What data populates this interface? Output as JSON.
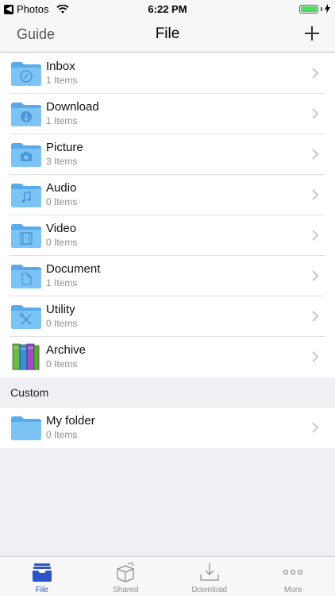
{
  "status_bar": {
    "back_app": "Photos",
    "time": "6:22 PM"
  },
  "navbar": {
    "left": "Guide",
    "title": "File",
    "add_icon": "plus-icon"
  },
  "folders": [
    {
      "name": "Inbox",
      "count": "1 Items",
      "icon": "inbox-folder-icon"
    },
    {
      "name": "Download",
      "count": "1 Items",
      "icon": "download-folder-icon"
    },
    {
      "name": "Picture",
      "count": "3 Items",
      "icon": "picture-folder-icon"
    },
    {
      "name": "Audio",
      "count": "0 Items",
      "icon": "audio-folder-icon"
    },
    {
      "name": "Video",
      "count": "0 Items",
      "icon": "video-folder-icon"
    },
    {
      "name": "Document",
      "count": "1 Items",
      "icon": "document-folder-icon"
    },
    {
      "name": "Utility",
      "count": "0 Items",
      "icon": "utility-folder-icon"
    },
    {
      "name": "Archive",
      "count": "0 Items",
      "icon": "archive-books-icon"
    }
  ],
  "custom_section": {
    "header": "Custom",
    "folders": [
      {
        "name": "My folder",
        "count": "0 Items",
        "icon": "folder-icon"
      }
    ]
  },
  "tabbar": {
    "tabs": [
      {
        "label": "File",
        "icon": "file-tray-icon",
        "active": true
      },
      {
        "label": "Shared",
        "icon": "shared-box-icon",
        "active": false
      },
      {
        "label": "Download",
        "icon": "download-tray-icon",
        "active": false
      },
      {
        "label": "More",
        "icon": "more-dots-icon",
        "active": false
      }
    ]
  },
  "colors": {
    "folder": "#6fb8f0",
    "accent": "#2a54c8",
    "battery": "#4cd964"
  }
}
